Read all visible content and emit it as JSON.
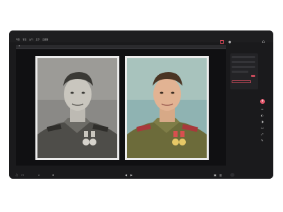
{
  "menu": [
    "파일",
    "편집",
    "보기",
    "도구",
    "도움말"
  ],
  "toolbar": {
    "record_icon": "record-icon",
    "eye_icon": "eye-icon",
    "account_icon": "user-icon"
  },
  "sidebar": {
    "labels": [
      "",
      "",
      "",
      "",
      ""
    ],
    "tools": [
      "+",
      "↔",
      "◐",
      "◑",
      "☐",
      "⤢",
      "✎"
    ]
  },
  "bottom": {
    "left_icons": [
      "⛶",
      "↔",
      "⌕",
      "⊕"
    ],
    "zoom": "",
    "nav_prev": "◀",
    "nav_next": "▶",
    "export_label": ""
  },
  "colors": {
    "accent": "#e0566a",
    "frame_bg": "#1a1a1c"
  }
}
